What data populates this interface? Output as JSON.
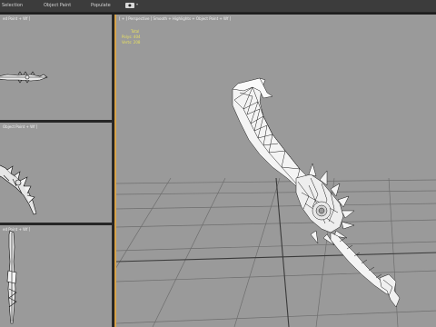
{
  "ribbon": {
    "tabs": [
      "Selection",
      "Object Paint",
      "Populate"
    ],
    "toggle_label": "●"
  },
  "viewports": {
    "top": {
      "label": "ed Point + Wf ]"
    },
    "front": {
      "label": "Object Point + Wf ]"
    },
    "left": {
      "label": "ed Point + Wf ]"
    },
    "perspective": {
      "label": "[ + ] Perspective ] Smooth + Highlights + Object Point + Wf ]"
    }
  },
  "stats": {
    "total": "Total",
    "polys": "Polys: 404",
    "verts": "Verts: 208"
  },
  "colors": {
    "viewport_bg": "#9a9a9a",
    "active_border": "#d8a34a",
    "stats_text": "#e8e060",
    "mesh_fill": "#f4f4f4",
    "mesh_edge": "#1a1a1a"
  }
}
